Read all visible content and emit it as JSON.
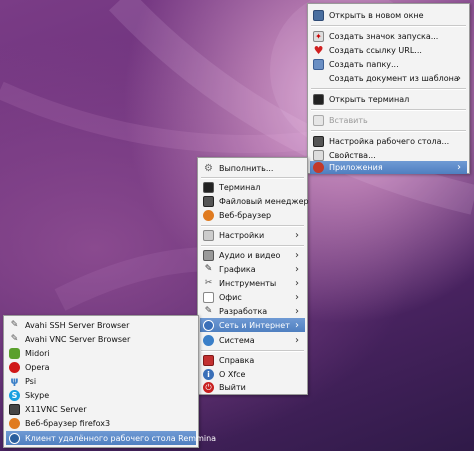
{
  "desktop_menu": {
    "items": [
      {
        "label": "Открыть в новом окне"
      },
      {
        "label": "Создать значок запуска..."
      },
      {
        "label": "Создать ссылку URL..."
      },
      {
        "label": "Создать папку..."
      },
      {
        "label": "Создать документ из шаблона"
      },
      {
        "label": "Открыть терминал"
      },
      {
        "label": "Вставить"
      },
      {
        "label": "Настройка рабочего стола..."
      },
      {
        "label": "Свойства..."
      },
      {
        "label": "Приложения"
      }
    ]
  },
  "apps_menu": {
    "items": [
      {
        "label": "Выполнить..."
      },
      {
        "label": "Терминал"
      },
      {
        "label": "Файловый менеджер"
      },
      {
        "label": "Веб-браузер"
      },
      {
        "label": "Настройки"
      },
      {
        "label": "Аудио и видео"
      },
      {
        "label": "Графика"
      },
      {
        "label": "Инструменты"
      },
      {
        "label": "Офис"
      },
      {
        "label": "Разработка"
      },
      {
        "label": "Сеть и Интернет"
      },
      {
        "label": "Система"
      },
      {
        "label": "Справка"
      },
      {
        "label": "О Xfce"
      },
      {
        "label": "Выйти"
      }
    ]
  },
  "network_menu": {
    "items": [
      {
        "label": "Avahi SSH Server Browser"
      },
      {
        "label": "Avahi VNC Server Browser"
      },
      {
        "label": "Midori"
      },
      {
        "label": "Opera"
      },
      {
        "label": "Psi"
      },
      {
        "label": "Skype"
      },
      {
        "label": "X11VNC Server"
      },
      {
        "label": "Веб-браузер firefox3"
      },
      {
        "label": "Клиент удалённого рабочего стола Remmina"
      }
    ]
  },
  "colors": {
    "selection": "#5a88c8",
    "menu_bg": "#f3f3f3"
  },
  "arrow_glyph": "›"
}
